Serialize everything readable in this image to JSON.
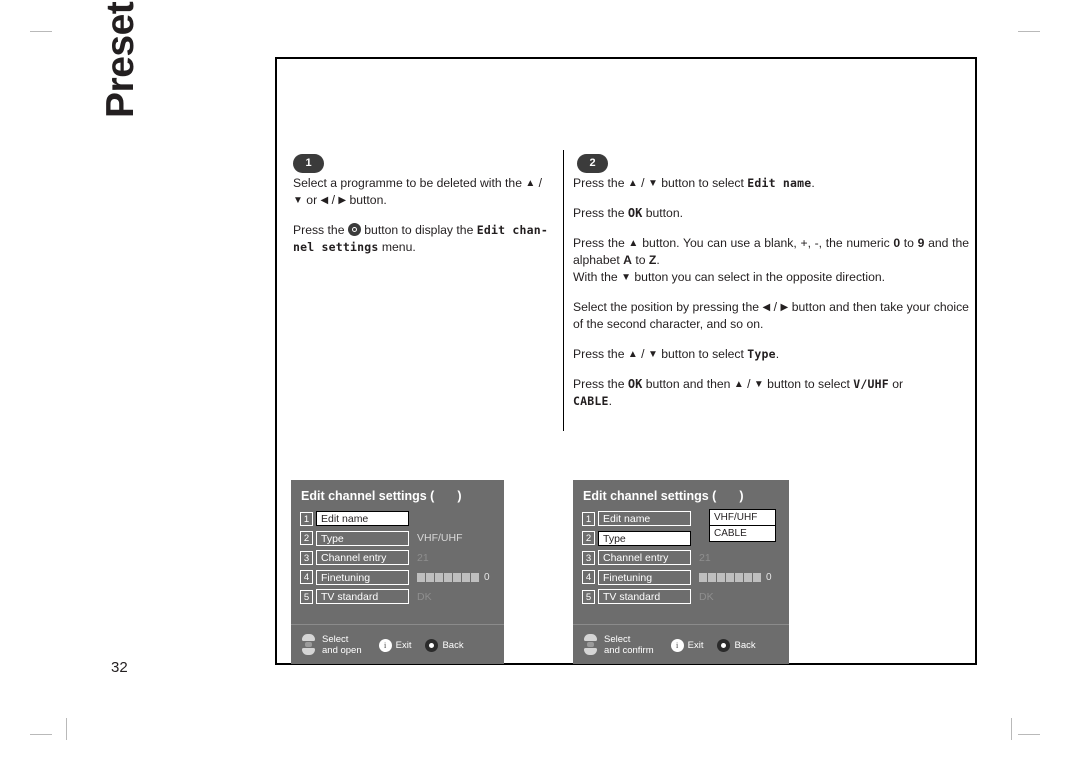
{
  "page": {
    "title": "Preset list Menu",
    "number": "32"
  },
  "steps": [
    {
      "badge": "1"
    },
    {
      "badge": "2"
    }
  ],
  "column1": {
    "p1_a": "Select a programme to be deleted with the ",
    "p1_b": " / ",
    "p1_c": " or ",
    "p1_d": " / ",
    "p1_e": " button.",
    "p2_a": "Press the ",
    "p2_b": " button to display the ",
    "p2_bold": "Edit chan-",
    "p2_bold2": "nel settings",
    "p2_c": " menu."
  },
  "column2": {
    "p1_a": "Press the ",
    "p1_b": " / ",
    "p1_c": " button to select ",
    "p1_bold": "Edit name",
    "p1_d": ".",
    "p2_a": "Press the ",
    "p2_ok": "OK",
    "p2_b": " button.",
    "p3_a": "Press the ",
    "p3_b": " button. You can use a blank, +, -, the numeric ",
    "p3_zero": "0",
    "p3_c": " to ",
    "p3_nine": "9",
    "p3_d": " and the alphabet ",
    "p3_A": "A",
    "p3_e": " to ",
    "p3_Z": "Z",
    "p3_f": ".",
    "p3_g": "With the ",
    "p3_h": " button you can select in the opposite direction.",
    "p4_a": "Select the position by pressing the ",
    "p4_b": " / ",
    "p4_c": " button and then take your choice of the second character, and so on.",
    "p5_a": "Press the ",
    "p5_b": " / ",
    "p5_c": " button to select ",
    "p5_bold": "Type",
    "p5_d": ".",
    "p6_a": "Press the ",
    "p6_ok": "OK",
    "p6_b": " button and then ",
    "p6_c": " / ",
    "p6_d": " button to select ",
    "p6_bold": "V/UHF",
    "p6_e": " or",
    "p6_bold2": "CABLE",
    "p6_f": "."
  },
  "osd1": {
    "title": "Edit channel settings (",
    "title_close": ")",
    "rows": [
      {
        "num": "1",
        "label": "Edit name",
        "value": "",
        "highlight": true
      },
      {
        "num": "2",
        "label": "Type",
        "value": "VHF/UHF",
        "highlight": false
      },
      {
        "num": "3",
        "label": "Channel entry",
        "value": "21",
        "highlight": false
      },
      {
        "num": "4",
        "label": "Finetuning",
        "value": "0",
        "highlight": false
      },
      {
        "num": "5",
        "label": "TV standard",
        "value": "DK",
        "highlight": false
      }
    ],
    "footer": {
      "nav_line1": "Select",
      "nav_line2": "and open",
      "exit_icon": "i",
      "exit_label": "Exit",
      "back_label": "Back"
    }
  },
  "osd2": {
    "title": "Edit channel settings (",
    "title_close": ")",
    "rows": [
      {
        "num": "1",
        "label": "Edit name",
        "value": "",
        "highlight": false
      },
      {
        "num": "2",
        "label": "Type",
        "value": "",
        "highlight": true
      },
      {
        "num": "3",
        "label": "Channel entry",
        "value": "21",
        "highlight": false
      },
      {
        "num": "4",
        "label": "Finetuning",
        "value": "0",
        "highlight": false
      },
      {
        "num": "5",
        "label": "TV standard",
        "value": "DK",
        "highlight": false
      }
    ],
    "popup": {
      "option1": "VHF/UHF",
      "option2": "CABLE"
    },
    "footer": {
      "nav_line1": "Select",
      "nav_line2": "and confirm",
      "exit_icon": "i",
      "exit_label": "Exit",
      "back_label": "Back"
    }
  }
}
